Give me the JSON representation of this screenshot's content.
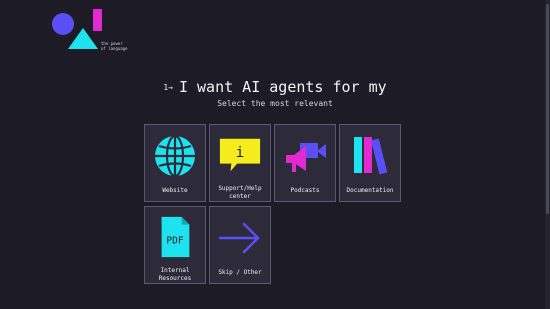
{
  "brand": {
    "tagline_line1": "the power",
    "tagline_line2": "of language",
    "colors": {
      "circle": "#5a4ff5",
      "triangle": "#1ee3ee",
      "bar": "#e22ad2"
    }
  },
  "heading": {
    "step": "1→",
    "title": "I want AI agents for my"
  },
  "subheading": "Select the most relevant",
  "options": [
    {
      "label": "Website",
      "icon": "globe-icon"
    },
    {
      "label": "Support/Help center",
      "icon": "info-speech-bubble-icon"
    },
    {
      "label": "Podcasts",
      "icon": "video-camera-megaphone-icon"
    },
    {
      "label": "Documentation",
      "icon": "books-icon"
    },
    {
      "label": "Internal Resources",
      "icon": "pdf-file-icon"
    },
    {
      "label": "Skip / Other",
      "icon": "arrow-right-icon"
    }
  ],
  "colors": {
    "background": "#1c1b26",
    "card": "#2d2b3a",
    "cyan": "#1ee3ee",
    "yellow": "#f4ec1d",
    "magenta": "#e22ad2",
    "violet": "#5a4ff5"
  }
}
